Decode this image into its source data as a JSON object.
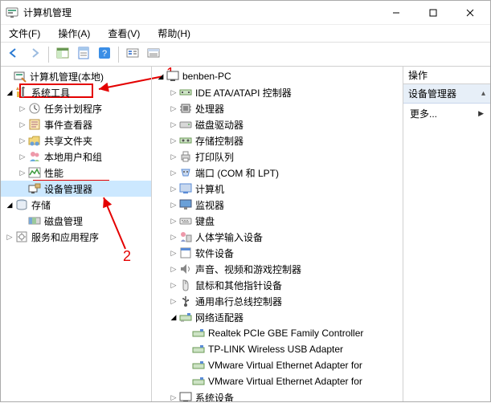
{
  "window": {
    "title": "计算机管理",
    "min_tip": "最小化",
    "max_tip": "最大化",
    "close_tip": "关闭"
  },
  "menu": {
    "file": "文件(F)",
    "action": "操作(A)",
    "view": "查看(V)",
    "help": "帮助(H)"
  },
  "annotations": {
    "label1": "1",
    "label2": "2"
  },
  "left_tree": {
    "root": "计算机管理(本地)",
    "system_tools": "系统工具",
    "task_scheduler": "任务计划程序",
    "event_viewer": "事件查看器",
    "shared_folders": "共享文件夹",
    "local_users": "本地用户和组",
    "performance": "性能",
    "device_manager": "设备管理器",
    "storage": "存储",
    "disk_mgmt": "磁盘管理",
    "services_apps": "服务和应用程序"
  },
  "center_tree": {
    "root": "benben-PC",
    "ide": "IDE ATA/ATAPI 控制器",
    "cpu": "处理器",
    "disc_drive": "磁盘驱动器",
    "storage_ctrl": "存储控制器",
    "print_queue": "打印队列",
    "ports": "端口 (COM 和 LPT)",
    "computer": "计算机",
    "monitor": "监视器",
    "keyboard": "键盘",
    "hid": "人体学输入设备",
    "software": "软件设备",
    "sound": "声音、视频和游戏控制器",
    "mouse": "鼠标和其他指针设备",
    "usb_ctrl": "通用串行总线控制器",
    "network": "网络适配器",
    "nic1": "Realtek PCIe GBE Family Controller",
    "nic2": "TP-LINK Wireless USB Adapter",
    "nic3": "VMware Virtual Ethernet Adapter for",
    "nic4": "VMware Virtual Ethernet Adapter for",
    "sysdev": "系统设备"
  },
  "right_pane": {
    "header": "操作",
    "title": "设备管理器",
    "more": "更多..."
  }
}
